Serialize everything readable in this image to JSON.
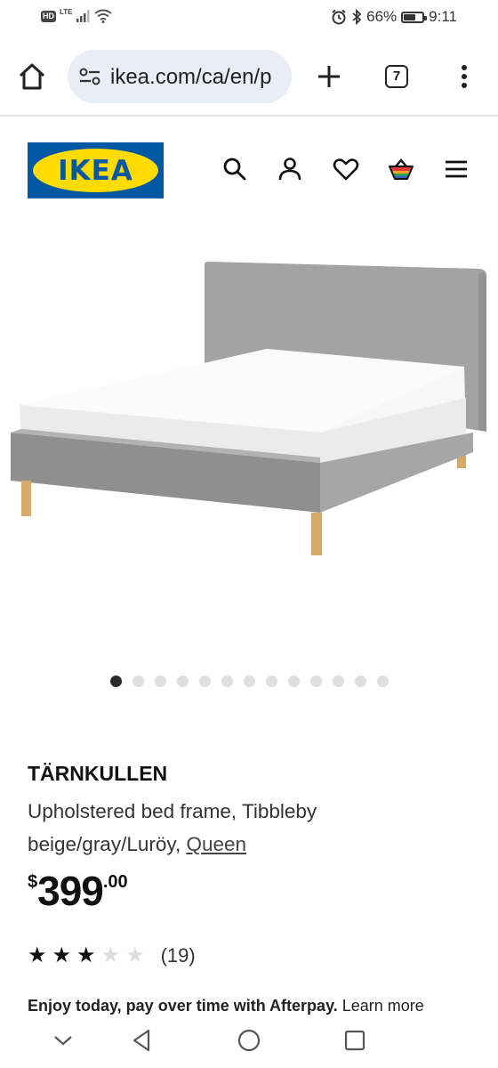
{
  "status_bar": {
    "hd": "HD",
    "network": "LTE",
    "battery_percent": "66%",
    "battery_level": 0.66,
    "time": "9:11"
  },
  "browser": {
    "url": "ikea.com/ca/en/p",
    "tab_count": "7"
  },
  "header": {
    "logo_text": "IKEA",
    "icons": [
      "search-icon",
      "account-icon",
      "heart-icon",
      "basket-icon",
      "hamburger-menu-icon"
    ]
  },
  "carousel": {
    "total_images": 13,
    "active_index": 0
  },
  "product": {
    "name": "TÄRNKULLEN",
    "description": "Upholstered bed frame, Tibbleby beige/gray/Luröy,",
    "size": "Queen",
    "price_currency": "$",
    "price_integer": "399",
    "price_decimal": ".00",
    "rating": 3,
    "rating_max": 5,
    "review_count": "(19)"
  },
  "afterpay": {
    "bold_text": "Enjoy today, pay over time with Afterpay.",
    "link_text": "Learn more"
  },
  "colors": {
    "ikea_blue": "#0058a3",
    "ikea_yellow": "#ffdb00",
    "url_bar_bg": "#e8edf6"
  }
}
